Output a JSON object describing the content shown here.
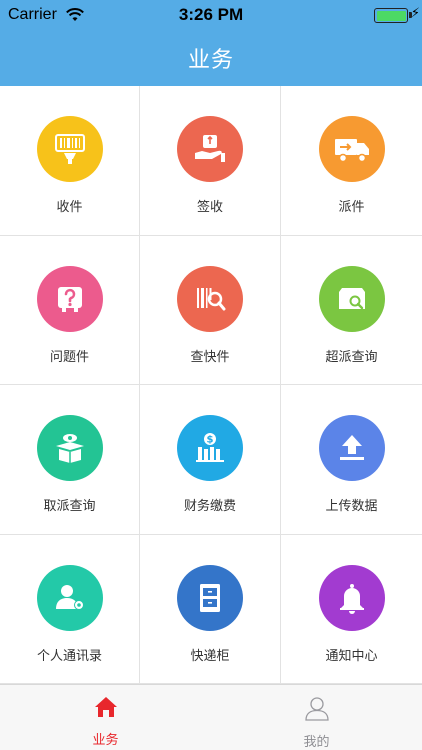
{
  "status_bar": {
    "carrier": "Carrier",
    "time": "3:26 PM"
  },
  "nav": {
    "title": "业务"
  },
  "grid": [
    {
      "label": "收件",
      "icon": "barcode-scanner-icon",
      "color": "#F7C21A"
    },
    {
      "label": "签收",
      "icon": "hand-package-icon",
      "color": "#EC6750"
    },
    {
      "label": "派件",
      "icon": "delivery-truck-icon",
      "color": "#F79A31"
    },
    {
      "label": "问题件",
      "icon": "question-box-icon",
      "color": "#EC5B8D"
    },
    {
      "label": "查快件",
      "icon": "barcode-search-icon",
      "color": "#EC6750"
    },
    {
      "label": "超派查询",
      "icon": "box-search-icon",
      "color": "#7BC641"
    },
    {
      "label": "取派查询",
      "icon": "open-box-eye-icon",
      "color": "#23C494"
    },
    {
      "label": "财务缴费",
      "icon": "money-bars-icon",
      "color": "#21A9E4"
    },
    {
      "label": "上传数据",
      "icon": "upload-icon",
      "color": "#5B84E8"
    },
    {
      "label": "个人通讯录",
      "icon": "contact-gear-icon",
      "color": "#23C9A8"
    },
    {
      "label": "快递柜",
      "icon": "cabinet-icon",
      "color": "#3475C9"
    },
    {
      "label": "通知中心",
      "icon": "bell-icon",
      "color": "#A23BD0"
    }
  ],
  "tabs": [
    {
      "label": "业务",
      "icon": "home-icon",
      "active": true
    },
    {
      "label": "我的",
      "icon": "user-icon",
      "active": false
    }
  ]
}
